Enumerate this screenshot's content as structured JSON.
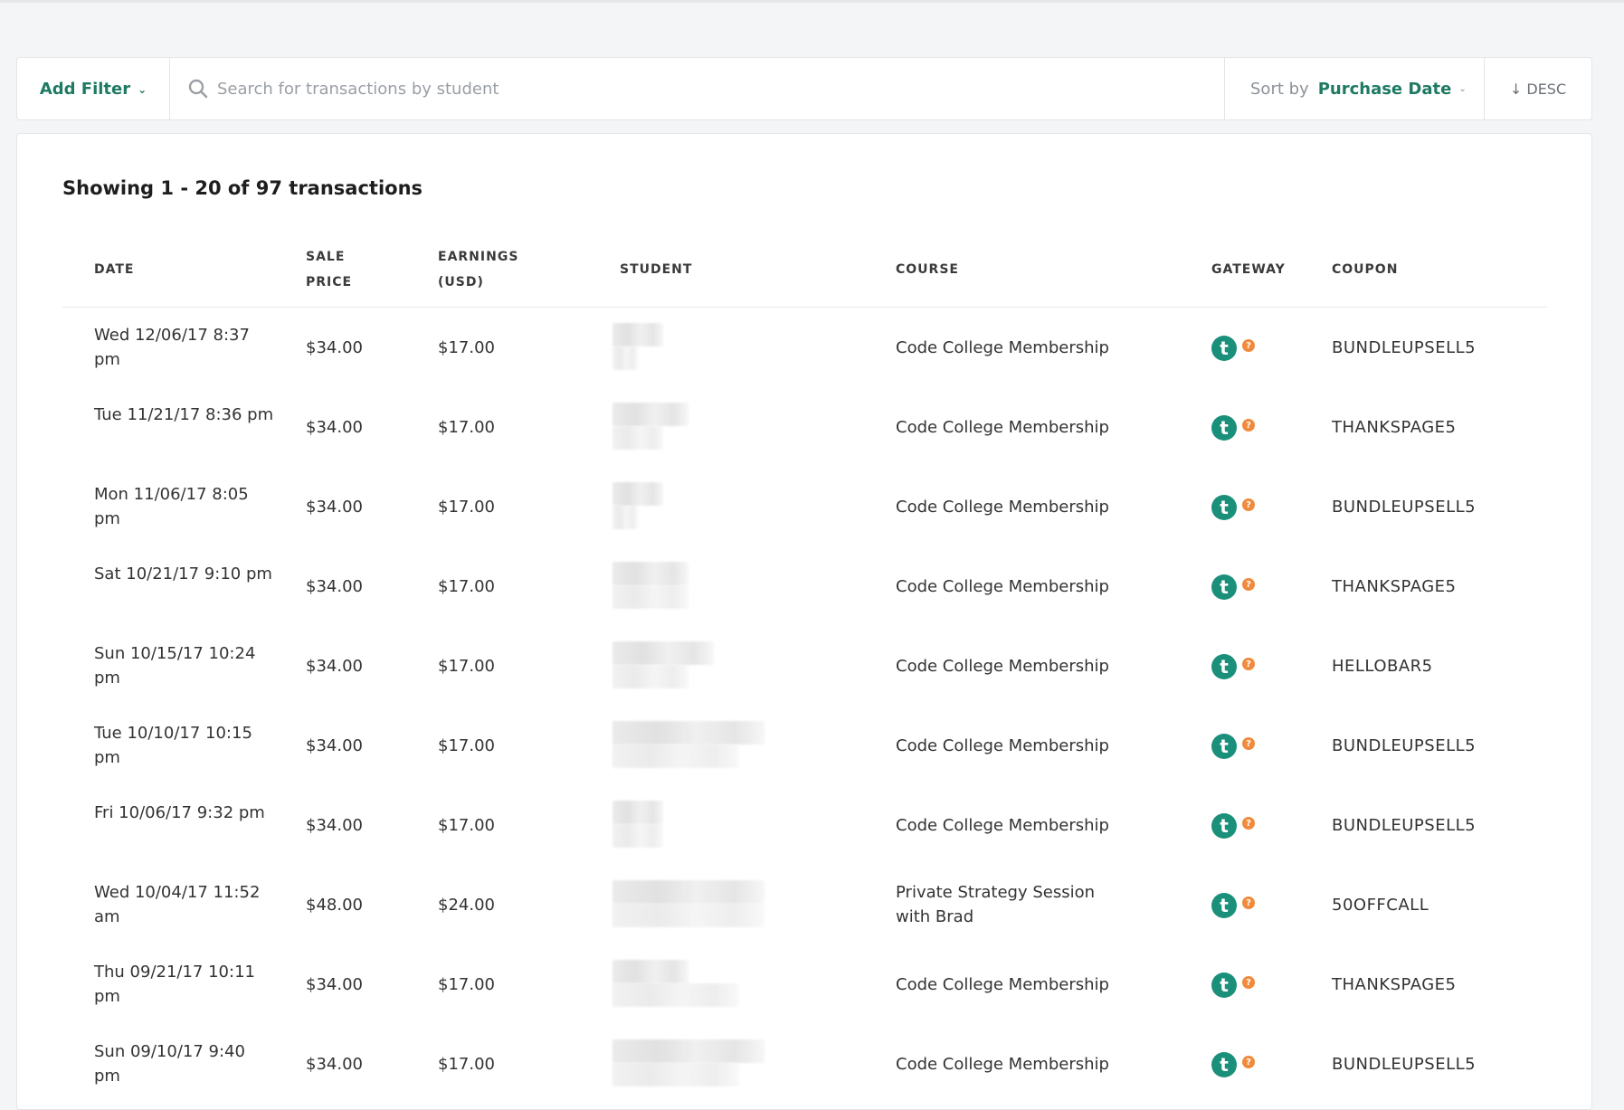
{
  "toolbar": {
    "add_filter_label": "Add Filter",
    "search_placeholder": "Search for transactions by student",
    "sort_label": "Sort by",
    "sort_value": "Purchase Date",
    "order_label": "↓ DESC"
  },
  "summary": "Showing 1 - 20 of 97 transactions",
  "columns": {
    "date": "DATE",
    "sale_price_1": "SALE",
    "sale_price_2": "PRICE",
    "earnings_1": "EARNINGS",
    "earnings_2": "(USD)",
    "student": "STUDENT",
    "course": "COURSE",
    "gateway": "GATEWAY",
    "coupon": "COUPON"
  },
  "gateway": {
    "badge": "t",
    "help": "?"
  },
  "rows": [
    {
      "date": "Wed 12/06/17 8:37 pm",
      "price": "$34.00",
      "earnings": "$17.00",
      "course": "Code College Membership",
      "coupon": "BUNDLEUPSELL5"
    },
    {
      "date": "Tue 11/21/17 8:36 pm",
      "price": "$34.00",
      "earnings": "$17.00",
      "course": "Code College Membership",
      "coupon": "THANKSPAGE5"
    },
    {
      "date": "Mon 11/06/17 8:05 pm",
      "price": "$34.00",
      "earnings": "$17.00",
      "course": "Code College Membership",
      "coupon": "BUNDLEUPSELL5"
    },
    {
      "date": "Sat 10/21/17 9:10 pm",
      "price": "$34.00",
      "earnings": "$17.00",
      "course": "Code College Membership",
      "coupon": "THANKSPAGE5"
    },
    {
      "date": "Sun 10/15/17 10:24 pm",
      "price": "$34.00",
      "earnings": "$17.00",
      "course": "Code College Membership",
      "coupon": "HELLOBAR5"
    },
    {
      "date": "Tue 10/10/17 10:15 pm",
      "price": "$34.00",
      "earnings": "$17.00",
      "course": "Code College Membership",
      "coupon": "BUNDLEUPSELL5"
    },
    {
      "date": "Fri 10/06/17 9:32 pm",
      "price": "$34.00",
      "earnings": "$17.00",
      "course": "Code College Membership",
      "coupon": "BUNDLEUPSELL5"
    },
    {
      "date": "Wed 10/04/17 11:52 am",
      "price": "$48.00",
      "earnings": "$24.00",
      "course": "Private Strategy Session with Brad",
      "coupon": "50OFFCALL"
    },
    {
      "date": "Thu 09/21/17 10:11 pm",
      "price": "$34.00",
      "earnings": "$17.00",
      "course": "Code College Membership",
      "coupon": "THANKSPAGE5"
    },
    {
      "date": "Sun 09/10/17 9:40 pm",
      "price": "$34.00",
      "earnings": "$17.00",
      "course": "Code College Membership",
      "coupon": "BUNDLEUPSELL5"
    }
  ],
  "colors": {
    "accent": "#1f7a63",
    "gateway_badge": "#1a8f7a",
    "help_badge": "#f08a3c"
  }
}
